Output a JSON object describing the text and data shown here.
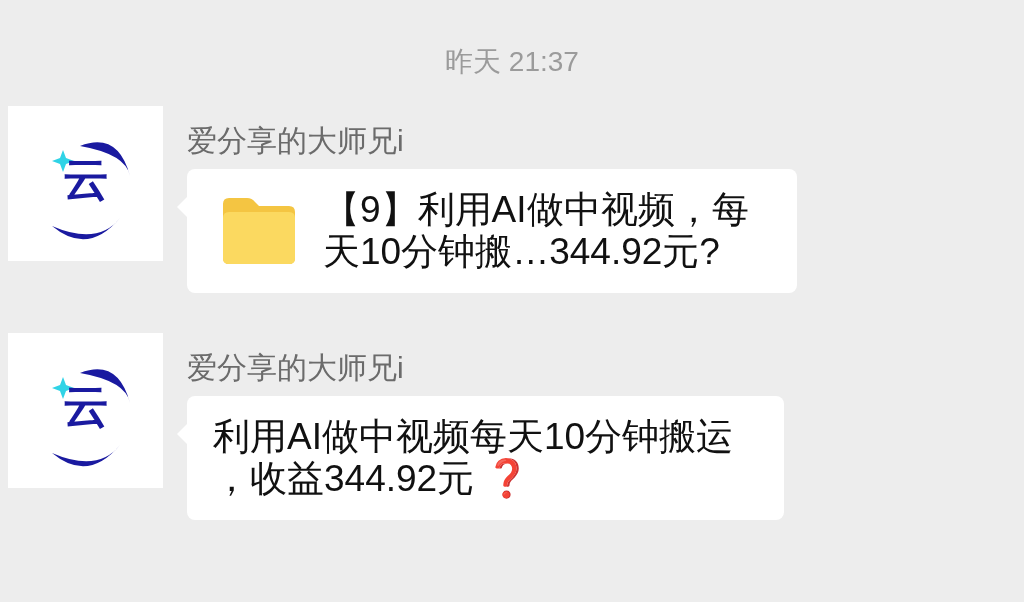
{
  "timestamp": "昨天 21:37",
  "messages": [
    {
      "kind": "file",
      "sender": "爱分享的大师兄i",
      "avatar_text": "云",
      "text": "【9】利用AI做中视频，每天10分钟搬…344.92元?"
    },
    {
      "kind": "text",
      "sender": "爱分享的大师兄i",
      "avatar_text": "云",
      "text": "利用AI做中视频每天10分钟搬运，收益344.92元",
      "emoji": "❓"
    }
  ]
}
